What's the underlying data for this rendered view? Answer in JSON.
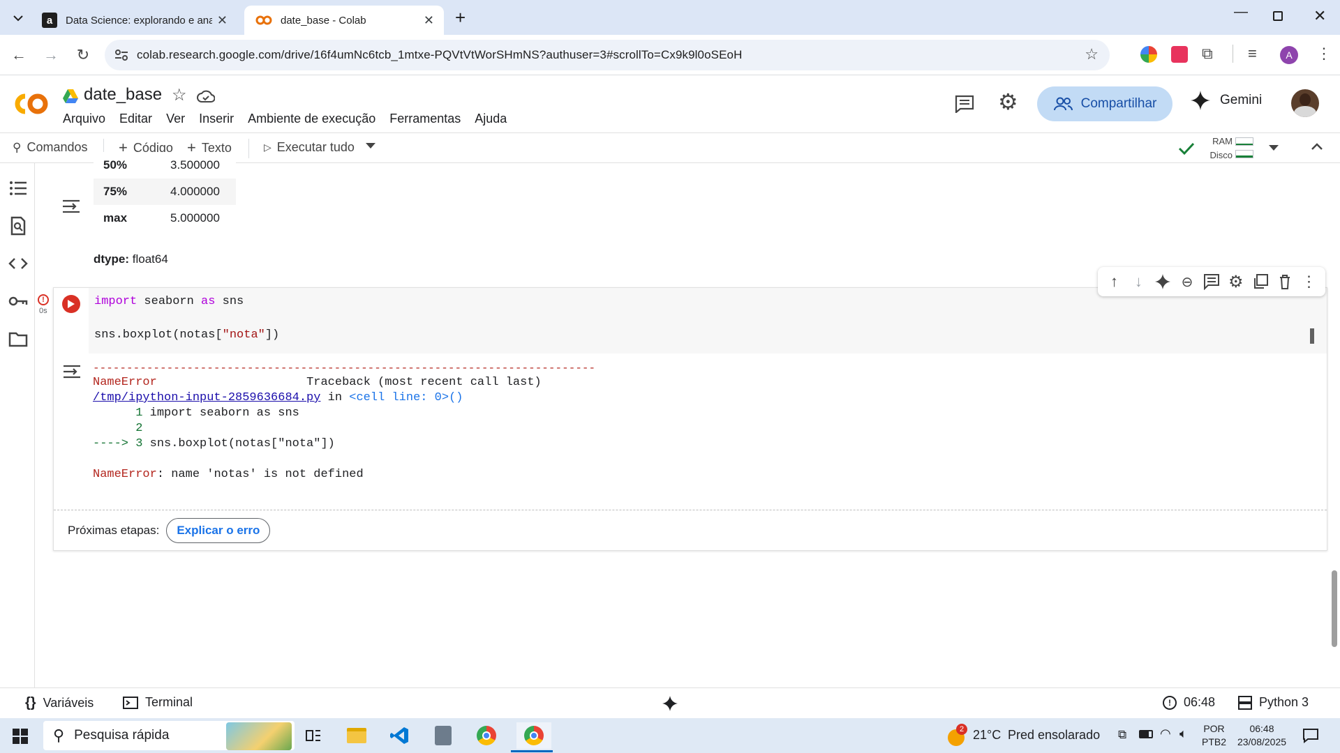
{
  "browser": {
    "tabs": [
      {
        "title": "Data Science: explorando e ana",
        "active": false
      },
      {
        "title": "date_base - Colab",
        "active": true
      }
    ],
    "url": "colab.research.google.com/drive/16f4umNc6tcb_1mtxe-PQVtVtWorSHmNS?authuser=3#scrollTo=Cx9k9l0oSEoH",
    "profile_initial": "A"
  },
  "colab": {
    "logo": "CO",
    "notebook_title": "date_base",
    "menu": [
      "Arquivo",
      "Editar",
      "Ver",
      "Inserir",
      "Ambiente de execução",
      "Ferramentas",
      "Ajuda"
    ],
    "share_label": "Compartilhar",
    "gemini_label": "Gemini",
    "toolbar": {
      "commands": "Comandos",
      "code": "Código",
      "text": "Texto",
      "run_all": "Executar tudo",
      "ram_label": "RAM",
      "disk_label": "Disco"
    }
  },
  "prev_output": {
    "rows": [
      {
        "key": "50%",
        "value": "3.500000"
      },
      {
        "key": "75%",
        "value": "4.000000"
      },
      {
        "key": "max",
        "value": "5.000000"
      }
    ],
    "dtype_label": "dtype:",
    "dtype_value": "float64"
  },
  "cell": {
    "exec_time": "0s",
    "code_line1": {
      "kw1": "import",
      "mid": " seaborn ",
      "kw2": "as",
      "end": " sns"
    },
    "code_line2": {
      "pre": "sns.boxplot(notas[",
      "str": "\"nota\"",
      "post": "])"
    },
    "traceback": {
      "dashes": "---------------------------------------------------------------------------",
      "error_name": "NameError",
      "traceback_label": "Traceback (most recent call last)",
      "file_link": "/tmp/ipython-input-2859636684.py",
      "in_word": "in",
      "cell_ref": "<cell line: 0>",
      "cell_parens": "()",
      "line1_num": "1",
      "line1_code": "import seaborn as sns",
      "line2_num": "2",
      "arrow": "---->",
      "line3_num": "3",
      "line3_code": "sns.boxplot(notas[\"nota\"])",
      "final_error_name": "NameError",
      "final_error_msg": ": name 'notas' is not defined"
    },
    "next_steps_label": "Próximas etapas:",
    "explain_error_label": "Explicar o erro"
  },
  "statusbar": {
    "variables": "Variáveis",
    "terminal": "Terminal",
    "time": "06:48",
    "runtime": "Python 3"
  },
  "taskbar": {
    "search_placeholder": "Pesquisa rápida",
    "weather_temp": "21°C",
    "weather_desc": "Pred ensolarado",
    "weather_badge": "2",
    "lang1": "POR",
    "lang2": "PTB2",
    "clock_time": "06:48",
    "clock_date": "23/08/2025"
  },
  "colors": {
    "accent": "#1a73e8",
    "error_red": "#b3261e",
    "run_red": "#d93025",
    "share_bg": "#c2dbf5",
    "colab_orange": "#f9ab00"
  }
}
